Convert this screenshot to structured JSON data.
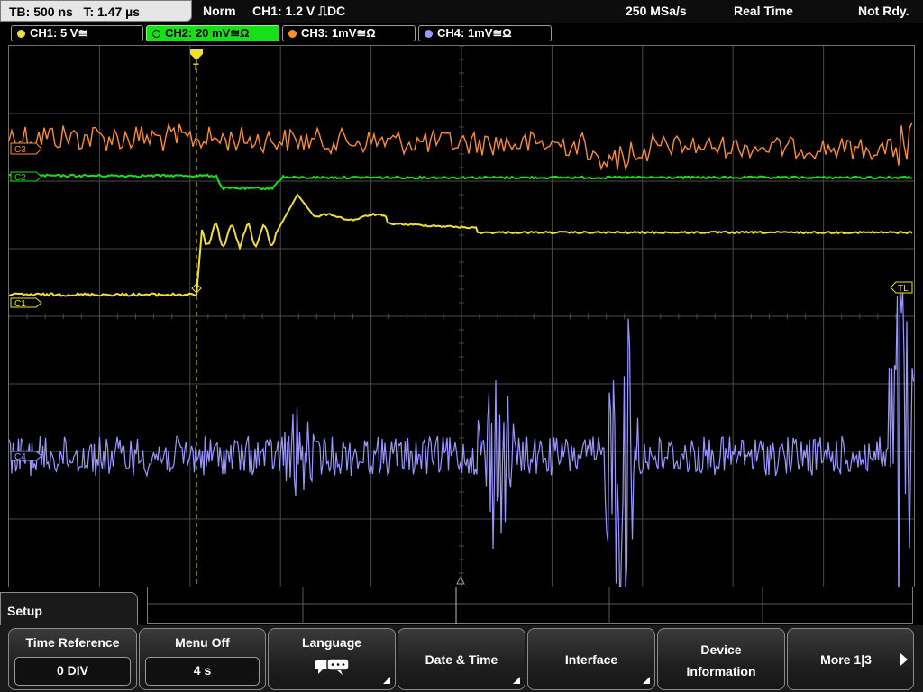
{
  "status": {
    "timebase": "TB: 500 ns",
    "trigger_time": "T: 1.47 µs",
    "mode": "Norm",
    "trigger": "CH1: 1.2 V ⎍DC",
    "sample_rate": "250 MSa/s",
    "acq_mode": "Real Time",
    "state": "Not Rdy."
  },
  "channels": [
    {
      "label": "CH1: 5 V≅",
      "color": "#f0e030",
      "dot_filled": true
    },
    {
      "label": "CH2: 20 mV≅Ω",
      "color": "#18e018",
      "dot_filled": false
    },
    {
      "label": "CH3: 1mV≅Ω",
      "color": "#ff8c2a",
      "dot_filled": true
    },
    {
      "label": "CH4: 1mV≅Ω",
      "color": "#9a96ff",
      "dot_filled": true
    }
  ],
  "markers": {
    "c3": "C3",
    "c2": "C2",
    "c1": "C1",
    "c4": "C4",
    "trigger_level": "TL",
    "trigger_position": "T"
  },
  "menu": {
    "title": "Setup",
    "time_reference": {
      "label": "Time Reference",
      "value": "0 DIV"
    },
    "menu_off": {
      "label": "Menu Off",
      "value": "4 s"
    },
    "language": {
      "label": "Language",
      "icon": "speech-bubbles-icon"
    },
    "date_time": "Date & Time",
    "interface": "Interface",
    "device_info_line1": "Device",
    "device_info_line2": "Information",
    "more": "More 1|3"
  },
  "colors": {
    "ch1": "#f0e030",
    "ch2": "#18e018",
    "ch3": "#ff8c2a",
    "ch4": "#9a96ff",
    "grid": "#4a4a4a"
  }
}
